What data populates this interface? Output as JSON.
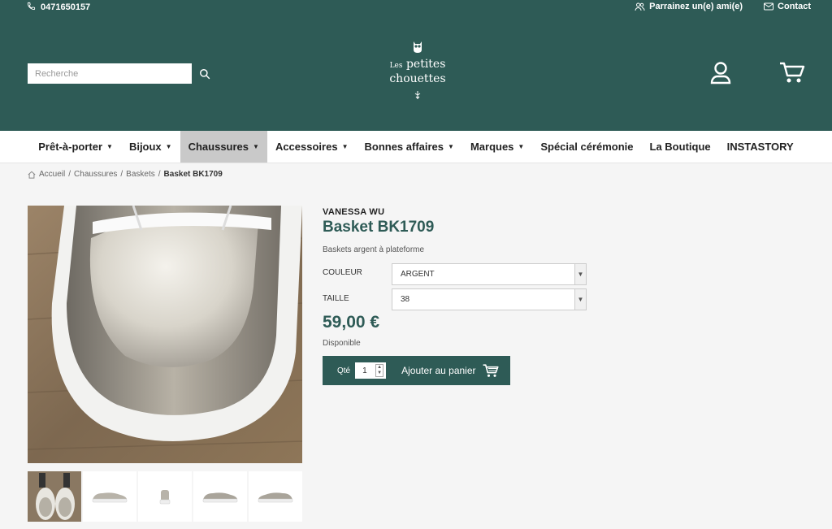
{
  "topbar": {
    "phone": "0471650157",
    "sponsor": "Parrainez un(e) ami(e)",
    "contact": "Contact"
  },
  "header": {
    "search_placeholder": "Recherche",
    "logo_line1_small": "Les",
    "logo_line1": "petites",
    "logo_line2": "chouettes"
  },
  "nav": {
    "items": [
      {
        "label": "Prêt-à-porter",
        "dropdown": true
      },
      {
        "label": "Bijoux",
        "dropdown": true
      },
      {
        "label": "Chaussures",
        "dropdown": true,
        "active": true
      },
      {
        "label": "Accessoires",
        "dropdown": true
      },
      {
        "label": "Bonnes affaires",
        "dropdown": true
      },
      {
        "label": "Marques",
        "dropdown": true
      },
      {
        "label": "Spécial cérémonie",
        "dropdown": false
      },
      {
        "label": "La Boutique",
        "dropdown": false
      },
      {
        "label": "INSTASTORY",
        "dropdown": false
      }
    ]
  },
  "breadcrumb": {
    "home": "Accueil",
    "sep": "/",
    "level1": "Chaussures",
    "level2": "Baskets",
    "current": "Basket BK1709"
  },
  "product": {
    "brand": "VANESSA WU",
    "title": "Basket BK1709",
    "subtitle": "Baskets argent à plateforme",
    "color_label": "COULEUR",
    "color_value": "ARGENT",
    "size_label": "TAILLE",
    "size_value": "38",
    "price": "59,00 €",
    "availability": "Disponible",
    "qty_label": "Qté",
    "qty_value": "1",
    "add_to_cart": "Ajouter au panier"
  },
  "colors": {
    "brand_green": "#2e5b56",
    "nav_active_bg": "#c9c9c9"
  }
}
